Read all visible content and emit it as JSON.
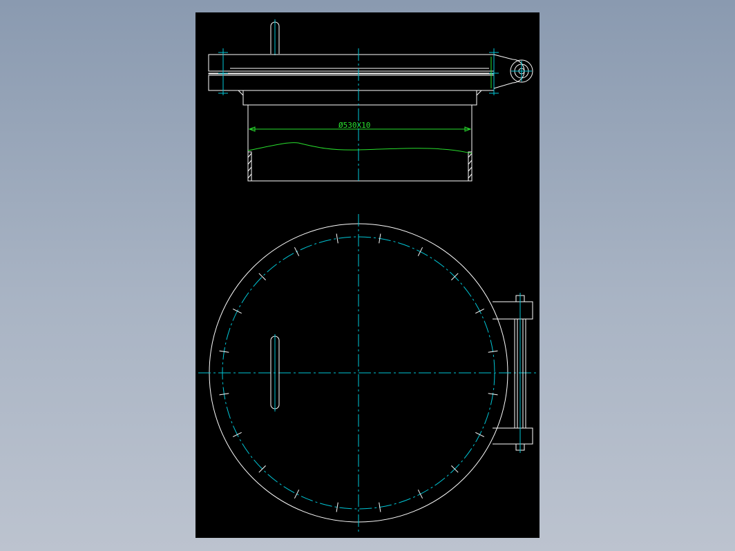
{
  "drawing": {
    "dimension_label": "Ø530X10",
    "colors": {
      "background": "#000000",
      "outline": "#ffffff",
      "centerline": "#00c8d8",
      "dimension": "#29e12e",
      "window_bg": "#9aa6b8"
    }
  }
}
